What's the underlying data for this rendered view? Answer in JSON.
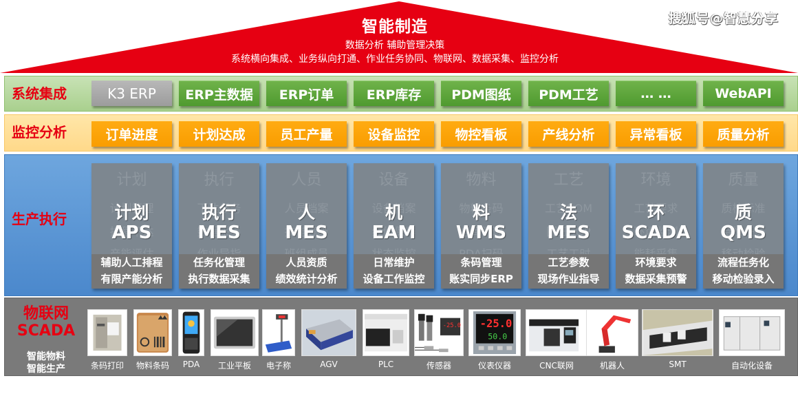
{
  "roof": {
    "title": "智能制造",
    "subtitle1": "数据分析 辅助管理决策",
    "subtitle2": "系统横向集成、业务纵向打通、作业任务协同、物联网、数据采集、监控分析",
    "watermark": "搜狐号@智慧分享",
    "color": "#e60012"
  },
  "system_integration": {
    "label": "系统集成",
    "items": [
      {
        "label": "K3 ERP",
        "style": "gray"
      },
      {
        "label": "ERP主数据",
        "style": "green"
      },
      {
        "label": "ERP订单",
        "style": "green"
      },
      {
        "label": "ERP库存",
        "style": "green"
      },
      {
        "label": "PDM图纸",
        "style": "green"
      },
      {
        "label": "PDM工艺",
        "style": "green"
      },
      {
        "label": "… …",
        "style": "green"
      },
      {
        "label": "WebAPI",
        "style": "green"
      }
    ]
  },
  "monitoring": {
    "label": "监控分析",
    "items": [
      "订单进度",
      "计划达成",
      "员工产量",
      "设备监控",
      "物控看板",
      "产线分析",
      "异常看板",
      "质量分析"
    ]
  },
  "production": {
    "label": "生产执行",
    "cards": [
      {
        "bg_title": "计划",
        "bg_lines": [
          "计划管理",
          "排程下达",
          "产能评估"
        ],
        "cn": "计划",
        "en": "APS",
        "foot": [
          "辅助人工排程",
          "有限产能分析"
        ]
      },
      {
        "bg_title": "执行",
        "bg_lines": [
          "下达任务",
          "数据采集",
          "作业导指"
        ],
        "cn": "执行",
        "en": "MES",
        "foot": [
          "任务化管理",
          "执行数据采集"
        ]
      },
      {
        "bg_title": "人员",
        "bg_lines": [
          "人员档案",
          "技能等级",
          "班组成员"
        ],
        "cn": "人",
        "en": "MES",
        "foot": [
          "人员资质",
          "绩效统计分析"
        ]
      },
      {
        "bg_title": "设备",
        "bg_lines": [
          "设备档案",
          "维修保养",
          "状态监控"
        ],
        "cn": "机",
        "en": "EAM",
        "foot": [
          "日常维护",
          "设备工作监控"
        ]
      },
      {
        "bg_title": "物料",
        "bg_lines": [
          "物料条码",
          "仓库管理",
          "PDA扫码"
        ],
        "cn": "料",
        "en": "WMS",
        "foot": [
          "条码管理",
          "账实同步ERP"
        ]
      },
      {
        "bg_title": "工艺",
        "bg_lines": [
          "工艺BOM",
          "图纸SOP",
          "工艺工时"
        ],
        "cn": "法",
        "en": "MES",
        "foot": [
          "工艺参数",
          "现场作业指导"
        ]
      },
      {
        "bg_title": "环境",
        "bg_lines": [
          "工艺要求",
          "环境监测",
          "能耗采集"
        ],
        "cn": "环",
        "en": "SCADA",
        "foot": [
          "环境要求",
          "数据采集预警"
        ]
      },
      {
        "bg_title": "质量",
        "bg_lines": [
          "质检标准",
          "待检任务",
          "移动检验"
        ],
        "cn": "质",
        "en": "QMS",
        "foot": [
          "流程任务化",
          "移动检验录入"
        ]
      }
    ]
  },
  "iot": {
    "label_line1": "物联网",
    "label_line2": "SCADA",
    "sub_line1": "智能物料",
    "sub_line2": "智能生产",
    "devices": [
      {
        "label": "条码打印",
        "icon": "barcode-printer"
      },
      {
        "label": "物料条码",
        "icon": "material-barcode-box"
      },
      {
        "label": "PDA",
        "icon": "pda-handheld"
      },
      {
        "label": "工业平板",
        "icon": "industrial-tablet"
      },
      {
        "label": "电子称",
        "icon": "electronic-scale"
      },
      {
        "label": "AGV",
        "icon": "agv-robot"
      },
      {
        "label": "PLC",
        "icon": "plc-controller"
      },
      {
        "label": "传感器",
        "icon": "sensor"
      },
      {
        "label": "仪表仪器",
        "icon": "instrument-meter",
        "readings": [
          "-25.0",
          "50.0"
        ]
      },
      {
        "label": "CNC联网",
        "icon": "cnc-machine"
      },
      {
        "label": "机器人",
        "icon": "industrial-robot"
      },
      {
        "label": "SMT",
        "icon": "smt-line"
      },
      {
        "label": "自动化设备",
        "icon": "automation-equipment"
      }
    ]
  }
}
